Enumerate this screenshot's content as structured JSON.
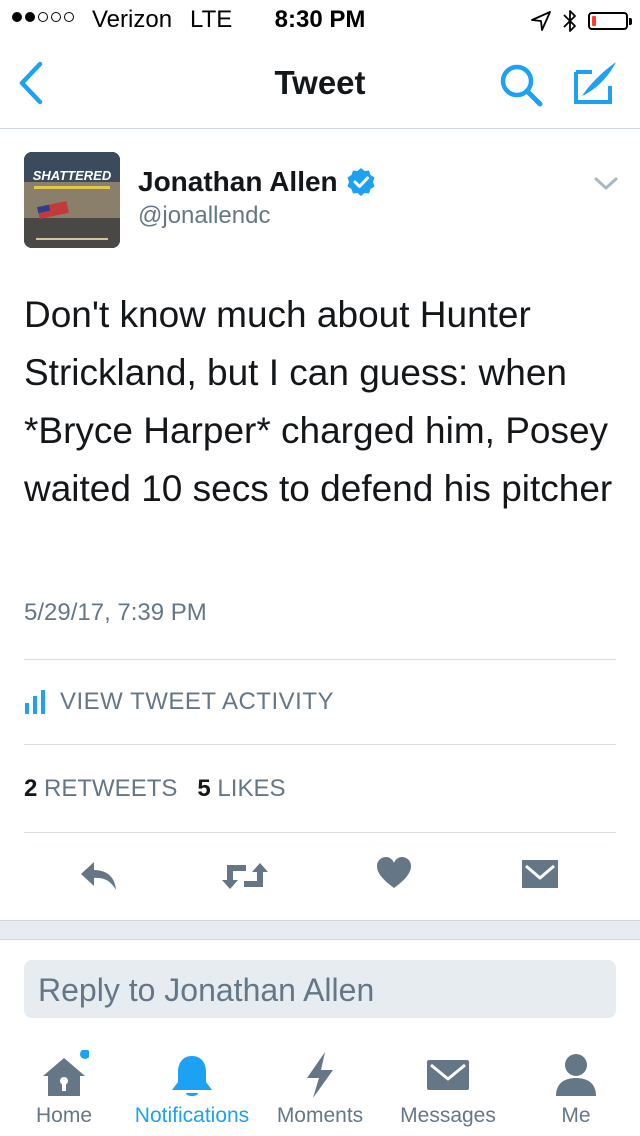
{
  "status_bar": {
    "carrier": "Verizon",
    "network": "LTE",
    "time": "8:30 PM",
    "signal_bars_filled": 2,
    "signal_bars_total": 5,
    "battery_level": 0.12,
    "icons": [
      "location-arrow-icon",
      "bluetooth-icon",
      "battery-icon"
    ]
  },
  "nav": {
    "title": "Tweet",
    "icons": [
      "back-chevron-icon",
      "search-icon",
      "compose-tweet-icon"
    ]
  },
  "tweet": {
    "author_name": "Jonathan Allen",
    "author_handle": "@jonallendc",
    "avatar_title": "SHATTERED",
    "text": "Don't know much about Hunter Strickland, but I can guess: when *Bryce Harper* charged him, Posey waited 10 secs to defend his pitcher",
    "timestamp": "5/29/17, 7:39 PM",
    "activity_label": "VIEW TWEET ACTIVITY",
    "retweet_count": "2",
    "retweet_label": "RETWEETS",
    "like_count": "5",
    "like_label": "LIKES"
  },
  "actions": [
    "reply-icon",
    "retweet-icon",
    "like-heart-icon",
    "direct-message-icon"
  ],
  "reply": {
    "placeholder": "Reply to Jonathan Allen"
  },
  "tabs": [
    {
      "label": "Home",
      "icon": "home-icon",
      "active": false,
      "has_dot": true
    },
    {
      "label": "Notifications",
      "icon": "bell-icon",
      "active": true
    },
    {
      "label": "Moments",
      "icon": "lightning-icon",
      "active": false
    },
    {
      "label": "Messages",
      "icon": "envelope-icon",
      "active": false
    },
    {
      "label": "Me",
      "icon": "person-icon",
      "active": false
    }
  ],
  "colors": {
    "accent": "#1da1f2",
    "secondary_text": "#657786",
    "icon_gray": "#657786",
    "verified": "#1da1f2",
    "battery_low": "#ff3b30"
  }
}
